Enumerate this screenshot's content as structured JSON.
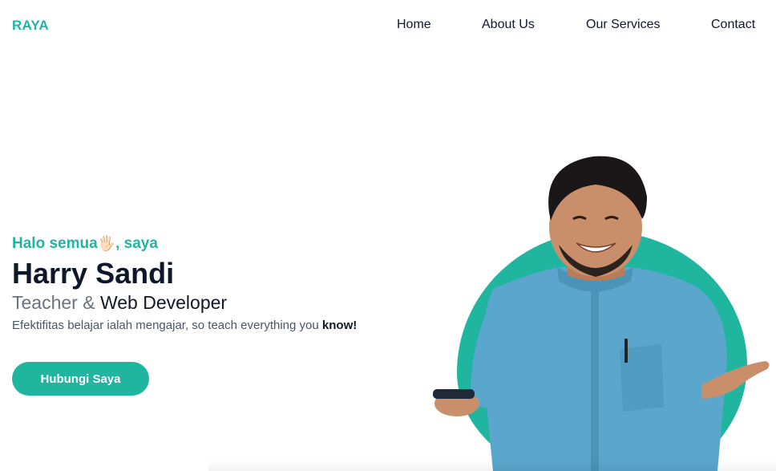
{
  "navbar": {
    "brand": "RAYA",
    "links": [
      {
        "label": "Home"
      },
      {
        "label": "About Us"
      },
      {
        "label": "Our Services"
      },
      {
        "label": "Contact"
      }
    ]
  },
  "hero": {
    "greeting_before": "Halo semua",
    "greeting_emoji": "🖐🏻",
    "greeting_after": ", saya",
    "name": "Harry Sandi",
    "role_part1": "Teacher &",
    "role_part2": "Web Developer",
    "tagline_text": "Efektifitas belajar ialah mengajar, so teach everything you",
    "tagline_emphasis": "know!",
    "cta_label": "Hubungi Saya"
  },
  "colors": {
    "accent": "#1fb59f",
    "heading": "#0f172a",
    "muted": "#6b7280",
    "shirt": "#5aa6cc"
  },
  "icons": [
    "waving-hand-icon"
  ]
}
